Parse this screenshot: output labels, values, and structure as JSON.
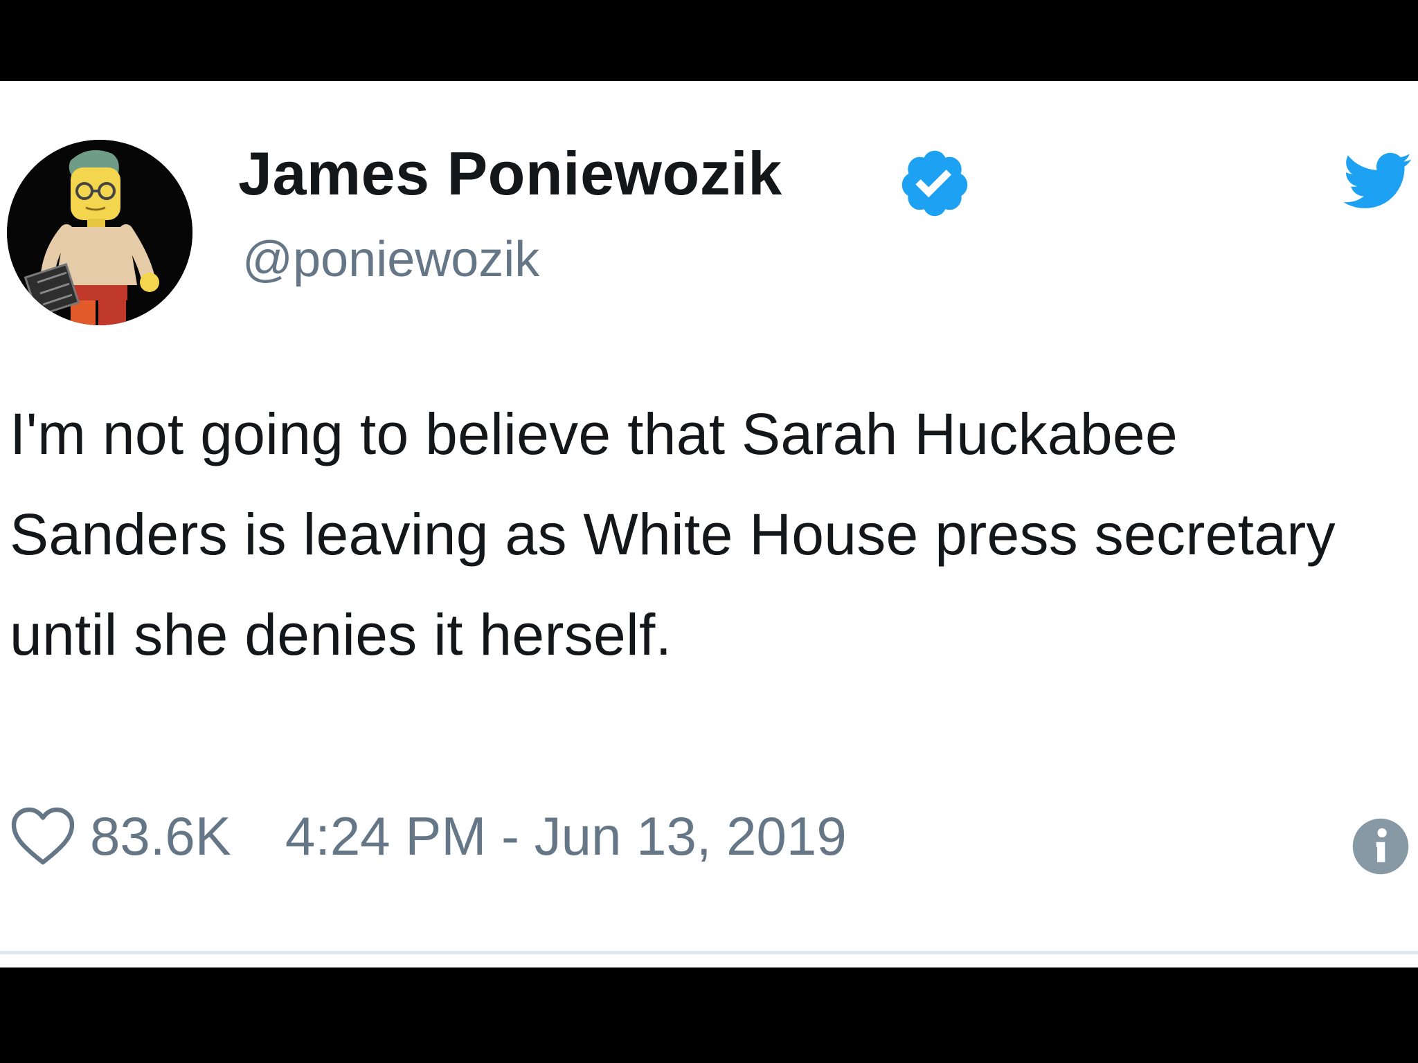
{
  "author": {
    "display_name": "James Poniewozik",
    "handle": "@poniewozik",
    "verified": true,
    "avatar_icon": "lego-minifigure-avatar"
  },
  "tweet": {
    "text": "I'm not going to believe that Sarah Huckabee Sanders is leaving as White House press secretary until she denies it herself.",
    "likes": "83.6K",
    "timestamp": "4:24 PM - Jun 13, 2019"
  },
  "icons": {
    "verified": "verified-badge-icon",
    "brand": "twitter-bird-icon",
    "like": "heart-icon",
    "info": "info-icon"
  },
  "colors": {
    "brand_blue": "#1da1f2",
    "text_primary": "#14171a",
    "text_secondary": "#657786",
    "background": "#ffffff",
    "letterbox": "#000000"
  }
}
